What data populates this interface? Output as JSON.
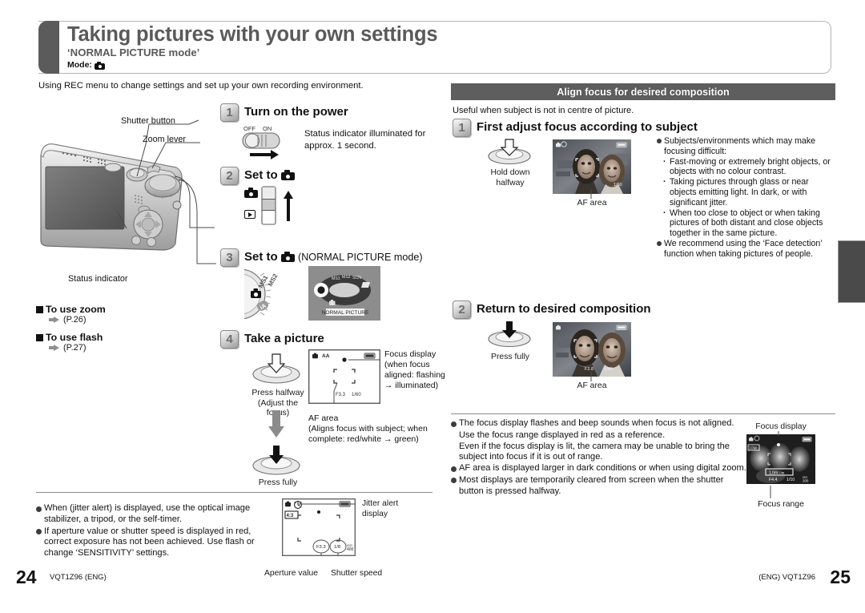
{
  "header": {
    "title": "Taking pictures with your own settings",
    "subtitle": "‘NORMAL PICTURE mode’",
    "mode_label": "Mode:",
    "intro": "Using REC menu to change settings and set up your own recording environment."
  },
  "left": {
    "camera_labels": {
      "shutter_button": "Shutter button",
      "zoom_lever": "Zoom lever",
      "status_indicator": "Status indicator"
    },
    "ref_sections": [
      {
        "heading": "To use zoom",
        "page": "(P.26)"
      },
      {
        "heading": "To use flash",
        "page": "(P.27)"
      }
    ],
    "steps": [
      {
        "number": "1",
        "title": "Turn on the power",
        "switch_off": "OFF",
        "switch_on": "ON",
        "text": "Status indicator illuminated for approx. 1 second."
      },
      {
        "number": "2",
        "title": "Set to"
      },
      {
        "number": "3",
        "title": "Set to",
        "note": "(NORMAL PICTURE mode)",
        "dial_labels": [
          "MS1",
          "MS2",
          "iA"
        ],
        "lcd_dial_labels": [
          "MS1",
          "MS2",
          "SCN"
        ],
        "lcd_caption": "NORMAL PICTURE"
      },
      {
        "number": "4",
        "title": "Take a picture",
        "press_halfway": "Press halfway\n(Adjust the\nfocus)",
        "press_fully": "Press fully",
        "focus_display_note": "Focus display\n(when focus\naligned: flashing\n→ illuminated)",
        "af_area_note": "AF area\n(Aligns focus with subject; when\ncomplete: red/white → green)",
        "lcd_aperture": "F3.3",
        "lcd_shutter": "1/60"
      }
    ],
    "notes": [
      "When (jitter alert) is displayed, use the optical image stabilizer, a tripod, or the self-timer.",
      "If aperture value or shutter speed is displayed in red, correct exposure has not been achieved. Use flash or change ‘SENSITIVITY’ settings."
    ],
    "jitter_diagram": {
      "jitter_alert_label": "Jitter alert\ndisplay",
      "aperture_label": "Aperture value",
      "shutter_label": "Shutter speed",
      "aperture_value": "F3.3",
      "shutter_value": "1/8",
      "iso_value": "ISO\n400",
      "corner_badge": "4:3"
    }
  },
  "right": {
    "section_title": "Align focus for desired composition",
    "intro": "Useful when subject is not in centre of picture.",
    "steps": [
      {
        "number": "1",
        "title": "First adjust focus according to subject",
        "button_label": "Hold down\nhalfway",
        "photo_label": "AF area",
        "photo_shutter": "1/60"
      },
      {
        "number": "2",
        "title": "Return to desired composition",
        "button_label": "Press fully",
        "photo_label": "AF area",
        "photo_aperture": "F2.8",
        "photo_shutter": "1/40"
      }
    ],
    "focus_notes": [
      "Subjects/environments which may make focusing difficult:",
      "We recommend using the ‘Face detection’ function when taking pictures of people."
    ],
    "focus_sub_notes": [
      "Fast-moving or extremely bright objects, or objects with no colour contrast.",
      "Taking pictures through glass or near objects emitting light. In dark, or with significant jitter.",
      "When too close to object or when taking pictures of both distant and close objects together in the same picture."
    ],
    "bottom_notes": [
      "The focus display flashes and beep sounds when focus is not aligned.",
      "AF area is displayed larger in dark conditions or when using digital zoom.",
      "Most displays are temporarily cleared from screen when the shutter button is pressed halfway."
    ],
    "bottom_note_continuations": [
      "Use the focus range displayed in red as a reference.",
      "Even if the focus display is lit, the camera may be unable to bring the subject into focus if it is out of range."
    ],
    "focus_diagram": {
      "focus_display_label": "Focus display",
      "focus_range_label": "Focus range",
      "aperture_value": "F4.4",
      "shutter_value": "1/10",
      "iso_value": "ISO\n200",
      "range_value": "1.0m - ∞"
    }
  },
  "footer": {
    "left_page": "24",
    "left_code": "VQT1Z96 (ENG)",
    "right_code": "(ENG) VQT1Z96",
    "right_page": "25"
  },
  "colors": {
    "header_tab": "#5b5b5b",
    "section_bar": "#5e5e5e",
    "title_gray": "#5a5a5a",
    "text": "#1a1a1a"
  }
}
